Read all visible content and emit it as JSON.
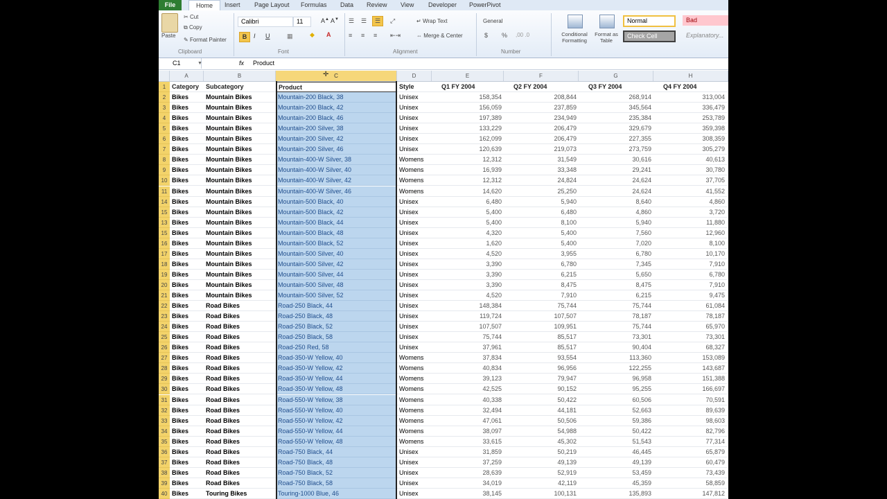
{
  "ribbon": {
    "tabs": [
      "File",
      "Home",
      "Insert",
      "Page Layout",
      "Formulas",
      "Data",
      "Review",
      "View",
      "Developer",
      "PowerPivot"
    ],
    "clipboard": {
      "paste": "Paste",
      "cut": "Cut",
      "copy": "Copy",
      "format_painter": "Format Painter",
      "group": "Clipboard"
    },
    "font": {
      "name": "Calibri",
      "size": "11",
      "group": "Font",
      "bold": "B",
      "italic": "I",
      "underline": "U"
    },
    "alignment": {
      "wrap": "Wrap Text",
      "merge": "Merge & Center",
      "group": "Alignment"
    },
    "number": {
      "format": "General",
      "group": "Number",
      "currency": "$",
      "percent": "%"
    },
    "styles": {
      "conditional": "Conditional Formatting",
      "format_table": "Format as Table",
      "normal": "Normal",
      "bad": "Bad",
      "explanatory": "Explanatory...",
      "check_cell": "Check Cell"
    }
  },
  "formula_bar": {
    "name_box": "C1",
    "fx": "fx",
    "value": "Product"
  },
  "columns": [
    "A",
    "B",
    "C",
    "D",
    "E",
    "F",
    "G",
    "H"
  ],
  "header_row": {
    "num": "1",
    "cells": [
      "Category",
      "Subcategory",
      "Product",
      "Style",
      "Q1 FY 2004",
      "Q2 FY 2004",
      "Q3 FY 2004",
      "Q4 FY 2004"
    ]
  },
  "rows": [
    {
      "num": "2",
      "cells": [
        "Bikes",
        "Mountain Bikes",
        "Mountain-200 Black, 38",
        "Unisex",
        "158,354",
        "208,844",
        "268,914",
        "313,004"
      ]
    },
    {
      "num": "3",
      "cells": [
        "Bikes",
        "Mountain Bikes",
        "Mountain-200 Black, 42",
        "Unisex",
        "156,059",
        "237,859",
        "345,564",
        "336,479"
      ]
    },
    {
      "num": "4",
      "cells": [
        "Bikes",
        "Mountain Bikes",
        "Mountain-200 Black, 46",
        "Unisex",
        "197,389",
        "234,949",
        "235,384",
        "253,789"
      ]
    },
    {
      "num": "5",
      "cells": [
        "Bikes",
        "Mountain Bikes",
        "Mountain-200 Silver, 38",
        "Unisex",
        "133,229",
        "206,479",
        "329,679",
        "359,398"
      ]
    },
    {
      "num": "6",
      "cells": [
        "Bikes",
        "Mountain Bikes",
        "Mountain-200 Silver, 42",
        "Unisex",
        "162,099",
        "206,479",
        "227,355",
        "308,359"
      ]
    },
    {
      "num": "7",
      "cells": [
        "Bikes",
        "Mountain Bikes",
        "Mountain-200 Silver, 46",
        "Unisex",
        "120,639",
        "219,073",
        "273,759",
        "305,279"
      ]
    },
    {
      "num": "8",
      "cells": [
        "Bikes",
        "Mountain Bikes",
        "Mountain-400-W Silver, 38",
        "Womens",
        "12,312",
        "31,549",
        "30,616",
        "40,613"
      ]
    },
    {
      "num": "9",
      "cells": [
        "Bikes",
        "Mountain Bikes",
        "Mountain-400-W Silver, 40",
        "Womens",
        "16,939",
        "33,348",
        "29,241",
        "30,780"
      ]
    },
    {
      "num": "10",
      "cells": [
        "Bikes",
        "Mountain Bikes",
        "Mountain-400-W Silver, 42",
        "Womens",
        "12,312",
        "24,824",
        "24,624",
        "37,705"
      ]
    },
    {
      "num": "11",
      "cells": [
        "Bikes",
        "Mountain Bikes",
        "Mountain-400-W Silver, 46",
        "Womens",
        "14,620",
        "25,250",
        "24,624",
        "41,552"
      ]
    },
    {
      "num": "14",
      "cells": [
        "Bikes",
        "Mountain Bikes",
        "Mountain-500 Black, 40",
        "Unisex",
        "6,480",
        "5,940",
        "8,640",
        "4,860"
      ]
    },
    {
      "num": "15",
      "cells": [
        "Bikes",
        "Mountain Bikes",
        "Mountain-500 Black, 42",
        "Unisex",
        "5,400",
        "6,480",
        "4,860",
        "3,720"
      ]
    },
    {
      "num": "13",
      "cells": [
        "Bikes",
        "Mountain Bikes",
        "Mountain-500 Black, 44",
        "Unisex",
        "5,400",
        "8,100",
        "5,940",
        "11,880"
      ]
    },
    {
      "num": "15",
      "cells": [
        "Bikes",
        "Mountain Bikes",
        "Mountain-500 Black, 48",
        "Unisex",
        "4,320",
        "5,400",
        "7,560",
        "12,960"
      ]
    },
    {
      "num": "16",
      "cells": [
        "Bikes",
        "Mountain Bikes",
        "Mountain-500 Black, 52",
        "Unisex",
        "1,620",
        "5,400",
        "7,020",
        "8,100"
      ]
    },
    {
      "num": "17",
      "cells": [
        "Bikes",
        "Mountain Bikes",
        "Mountain-500 Silver, 40",
        "Unisex",
        "4,520",
        "3,955",
        "6,780",
        "10,170"
      ]
    },
    {
      "num": "18",
      "cells": [
        "Bikes",
        "Mountain Bikes",
        "Mountain-500 Silver, 42",
        "Unisex",
        "3,390",
        "6,780",
        "7,345",
        "7,910"
      ]
    },
    {
      "num": "19",
      "cells": [
        "Bikes",
        "Mountain Bikes",
        "Mountain-500 Silver, 44",
        "Unisex",
        "3,390",
        "6,215",
        "5,650",
        "6,780"
      ]
    },
    {
      "num": "20",
      "cells": [
        "Bikes",
        "Mountain Bikes",
        "Mountain-500 Silver, 48",
        "Unisex",
        "3,390",
        "8,475",
        "8,475",
        "7,910"
      ]
    },
    {
      "num": "21",
      "cells": [
        "Bikes",
        "Mountain Bikes",
        "Mountain-500 Silver, 52",
        "Unisex",
        "4,520",
        "7,910",
        "6,215",
        "9,475"
      ]
    },
    {
      "num": "22",
      "cells": [
        "Bikes",
        "Road Bikes",
        "Road-250 Black, 44",
        "Unisex",
        "148,384",
        "75,744",
        "75,744",
        "61,084"
      ]
    },
    {
      "num": "23",
      "cells": [
        "Bikes",
        "Road Bikes",
        "Road-250 Black, 48",
        "Unisex",
        "119,724",
        "107,507",
        "78,187",
        "78,187"
      ]
    },
    {
      "num": "24",
      "cells": [
        "Bikes",
        "Road Bikes",
        "Road-250 Black, 52",
        "Unisex",
        "107,507",
        "109,951",
        "75,744",
        "65,970"
      ]
    },
    {
      "num": "25",
      "cells": [
        "Bikes",
        "Road Bikes",
        "Road-250 Black, 58",
        "Unisex",
        "75,744",
        "85,517",
        "73,301",
        "73,301"
      ]
    },
    {
      "num": "26",
      "cells": [
        "Bikes",
        "Road Bikes",
        "Road-250 Red, 58",
        "Unisex",
        "37,961",
        "85,517",
        "90,404",
        "68,327"
      ]
    },
    {
      "num": "27",
      "cells": [
        "Bikes",
        "Road Bikes",
        "Road-350-W Yellow, 40",
        "Womens",
        "37,834",
        "93,554",
        "113,360",
        "153,089"
      ]
    },
    {
      "num": "28",
      "cells": [
        "Bikes",
        "Road Bikes",
        "Road-350-W Yellow, 42",
        "Womens",
        "40,834",
        "96,956",
        "122,255",
        "143,687"
      ]
    },
    {
      "num": "29",
      "cells": [
        "Bikes",
        "Road Bikes",
        "Road-350-W Yellow, 44",
        "Womens",
        "39,123",
        "79,947",
        "96,958",
        "151,388"
      ]
    },
    {
      "num": "30",
      "cells": [
        "Bikes",
        "Road Bikes",
        "Road-350-W Yellow, 48",
        "Womens",
        "42,525",
        "90,152",
        "95,255",
        "166,697"
      ]
    },
    {
      "num": "31",
      "cells": [
        "Bikes",
        "Road Bikes",
        "Road-550-W Yellow, 38",
        "Womens",
        "40,338",
        "50,422",
        "60,506",
        "70,591"
      ]
    },
    {
      "num": "32",
      "cells": [
        "Bikes",
        "Road Bikes",
        "Road-550-W Yellow, 40",
        "Womens",
        "32,494",
        "44,181",
        "52,663",
        "89,639"
      ]
    },
    {
      "num": "33",
      "cells": [
        "Bikes",
        "Road Bikes",
        "Road-550-W Yellow, 42",
        "Womens",
        "47,061",
        "50,506",
        "59,386",
        "98,603"
      ]
    },
    {
      "num": "34",
      "cells": [
        "Bikes",
        "Road Bikes",
        "Road-550-W Yellow, 44",
        "Womens",
        "38,097",
        "54,988",
        "50,422",
        "82,796"
      ]
    },
    {
      "num": "35",
      "cells": [
        "Bikes",
        "Road Bikes",
        "Road-550-W Yellow, 48",
        "Womens",
        "33,615",
        "45,302",
        "51,543",
        "77,314"
      ]
    },
    {
      "num": "36",
      "cells": [
        "Bikes",
        "Road Bikes",
        "Road-750 Black, 44",
        "Unisex",
        "31,859",
        "50,219",
        "46,445",
        "65,879"
      ]
    },
    {
      "num": "37",
      "cells": [
        "Bikes",
        "Road Bikes",
        "Road-750 Black, 48",
        "Unisex",
        "37,259",
        "49,139",
        "49,139",
        "60,479"
      ]
    },
    {
      "num": "38",
      "cells": [
        "Bikes",
        "Road Bikes",
        "Road-750 Black, 52",
        "Unisex",
        "28,639",
        "52,919",
        "53,459",
        "73,439"
      ]
    },
    {
      "num": "39",
      "cells": [
        "Bikes",
        "Road Bikes",
        "Road-750 Black, 58",
        "Unisex",
        "34,019",
        "42,119",
        "45,359",
        "58,859"
      ]
    },
    {
      "num": "40",
      "cells": [
        "Bikes",
        "Touring Bikes",
        "Touring-1000 Blue, 46",
        "Unisex",
        "38,145",
        "100,131",
        "135,893",
        "147,812"
      ]
    }
  ]
}
